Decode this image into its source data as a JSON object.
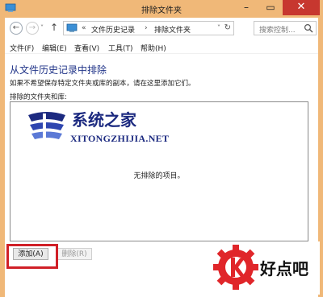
{
  "window": {
    "title": "排除文件夹"
  },
  "nav": {
    "recent_symbol": "˅",
    "up_symbol": "↑",
    "breadcrumbs": [
      {
        "sep": "«",
        "label": "文件历史记录"
      },
      {
        "sep": "›",
        "label": "排除文件夹"
      }
    ],
    "dropdown_symbol": "˅",
    "refresh_symbol": "↻",
    "search_placeholder": "搜索控制..."
  },
  "menu": [
    {
      "label": "文件(F)"
    },
    {
      "label": "编辑(E)"
    },
    {
      "label": "查看(V)"
    },
    {
      "label": "工具(T)"
    },
    {
      "label": "帮助(H)"
    }
  ],
  "content": {
    "heading": "从文件历史记录中排除",
    "description": "如果不希望保存特定文件夹或库的副本，请在这里添加它们。",
    "list_label": "排除的文件夹和库:",
    "empty_message": "无排除的项目。"
  },
  "buttons": {
    "add": "添加(A)",
    "remove": "删除(R)"
  },
  "watermark": {
    "text": "系统之家",
    "url": "XITONGZHIJIA.NET"
  },
  "brand": {
    "text": "好点吧"
  },
  "colors": {
    "frame": "#f0b878",
    "close": "#c7372f",
    "heading": "#1e3287",
    "highlight": "#d01f27",
    "brand_red": "#e0262a"
  }
}
